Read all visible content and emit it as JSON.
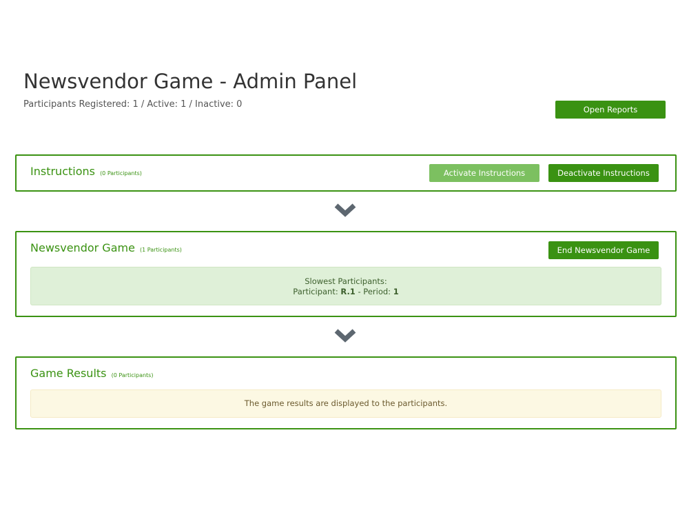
{
  "header": {
    "title": "Newsvendor Game - Admin Panel",
    "participants_line": "Participants Registered: 1 / Active: 1 / Inactive: 0",
    "open_reports_label": "Open Reports"
  },
  "panels": {
    "instructions": {
      "title": "Instructions",
      "count": "(0 Participants)",
      "activate_label": "Activate Instructions",
      "deactivate_label": "Deactivate Instructions"
    },
    "game": {
      "title": "Newsvendor Game",
      "count": "(1 Participants)",
      "end_label": "End Newsvendor Game",
      "slowest_heading": "Slowest Participants:",
      "participant_prefix": "Participant:",
      "participant_id": "R.1",
      "period_prefix": "- Period:",
      "period_value": "1"
    },
    "results": {
      "title": "Game Results",
      "count": "(0 Participants)",
      "message": "The game results are displayed to the participants."
    }
  },
  "icons": {
    "flow_arrow": "chevron-down-icon"
  },
  "colors": {
    "accent": "#3a9212",
    "accent_light": "#7cc060",
    "success_bg": "#dff0d8",
    "warning_bg": "#fcf8e3",
    "chevron": "#5d6770"
  }
}
